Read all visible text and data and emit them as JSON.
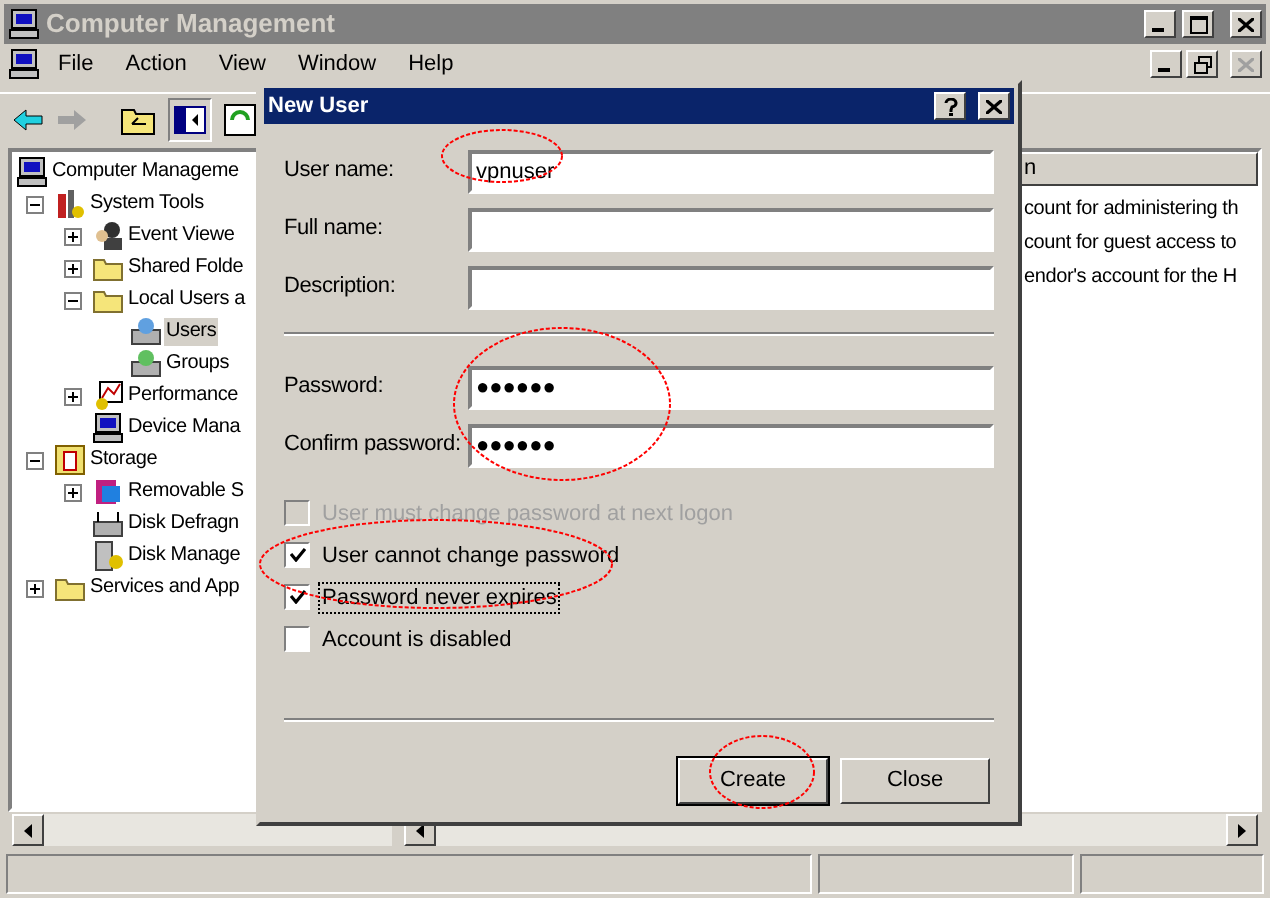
{
  "window": {
    "title": "Computer Management"
  },
  "menu": [
    {
      "label": "File"
    },
    {
      "label": "Action"
    },
    {
      "label": "View"
    },
    {
      "label": "Window"
    },
    {
      "label": "Help"
    }
  ],
  "tree": [
    {
      "label": "Computer Manageme",
      "selected": false,
      "children": [
        {
          "label": "System Tools",
          "expanded": true,
          "selected": false,
          "children": [
            {
              "label": "Event Viewe",
              "expanded": false,
              "selected": false
            },
            {
              "label": "Shared Folde",
              "expanded": false,
              "selected": false
            },
            {
              "label": "Local Users a",
              "expanded": true,
              "selected": false,
              "children": [
                {
                  "label": "Users",
                  "selected": true
                },
                {
                  "label": "Groups",
                  "selected": false
                }
              ]
            },
            {
              "label": "Performance",
              "expanded": false,
              "selected": false
            },
            {
              "label": "Device Mana",
              "selected": false
            }
          ]
        },
        {
          "label": "Storage",
          "expanded": true,
          "selected": false,
          "children": [
            {
              "label": "Removable S",
              "expanded": false,
              "selected": false
            },
            {
              "label": "Disk Defragn",
              "selected": false
            },
            {
              "label": "Disk Manage",
              "selected": false
            }
          ]
        },
        {
          "label": "Services and App",
          "expanded": false,
          "selected": false
        }
      ]
    }
  ],
  "list": {
    "column_1": "n",
    "rows": [
      "count for administering th",
      "count for guest access to",
      "endor's account for the H"
    ]
  },
  "dialog": {
    "title": "New User",
    "fields": [
      {
        "label": "User name:",
        "value": "vpnuser"
      },
      {
        "label": "Full name:"
      },
      {
        "label": "Description:"
      },
      {
        "label": "Password:",
        "value": "●●●●●●"
      },
      {
        "label": "Confirm password:",
        "value": "●●●●●●"
      }
    ],
    "checkboxes": [
      {
        "label": "User must change password at next logon",
        "checked": false,
        "disabled": true,
        "focused": false
      },
      {
        "label": "User cannot change password",
        "checked": true,
        "disabled": false,
        "focused": false
      },
      {
        "label": "Password never expires",
        "checked": true,
        "disabled": false,
        "focused": true
      },
      {
        "label": "Account is disabled",
        "checked": false,
        "disabled": false,
        "focused": false
      }
    ],
    "buttons": [
      {
        "label": "Create",
        "default": true
      },
      {
        "label": "Close",
        "default": false
      }
    ]
  }
}
